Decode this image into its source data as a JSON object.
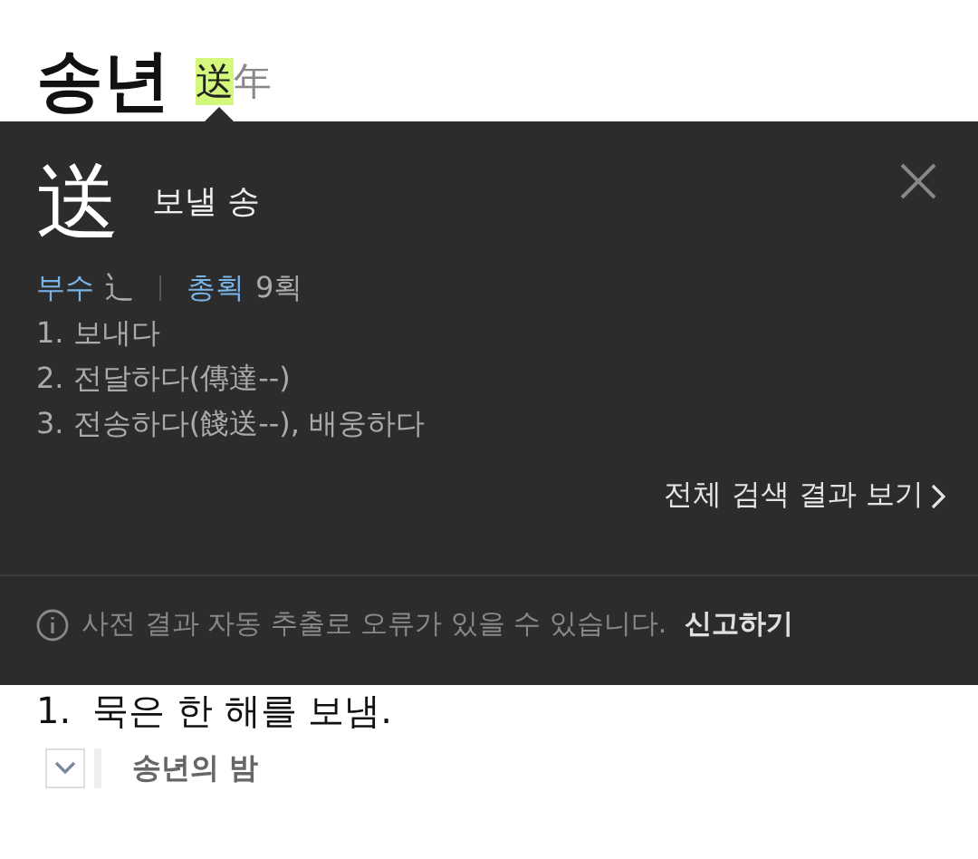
{
  "header": {
    "word": "송년",
    "hanja": [
      {
        "char": "送",
        "selected": true
      },
      {
        "char": "年",
        "selected": false
      }
    ]
  },
  "popup": {
    "character": "送",
    "reading": "보낼 송",
    "radical_label": "부수",
    "radical": "辶",
    "strokes_label": "총획",
    "strokes": "9획",
    "meanings": [
      "1. 보내다",
      "2. 전달하다(傳達--)",
      "3. 전송하다(餞送--), 배웅하다"
    ],
    "more_link": "전체 검색 결과 보기",
    "notice": "사전 결과 자동 추출로 오류가 있을 수 있습니다.",
    "report_link": "신고하기"
  },
  "definition": {
    "number": "1.",
    "text": "묵은 한 해를 보냄.",
    "example": {
      "text": "송년의 밤",
      "expanded": false
    }
  }
}
